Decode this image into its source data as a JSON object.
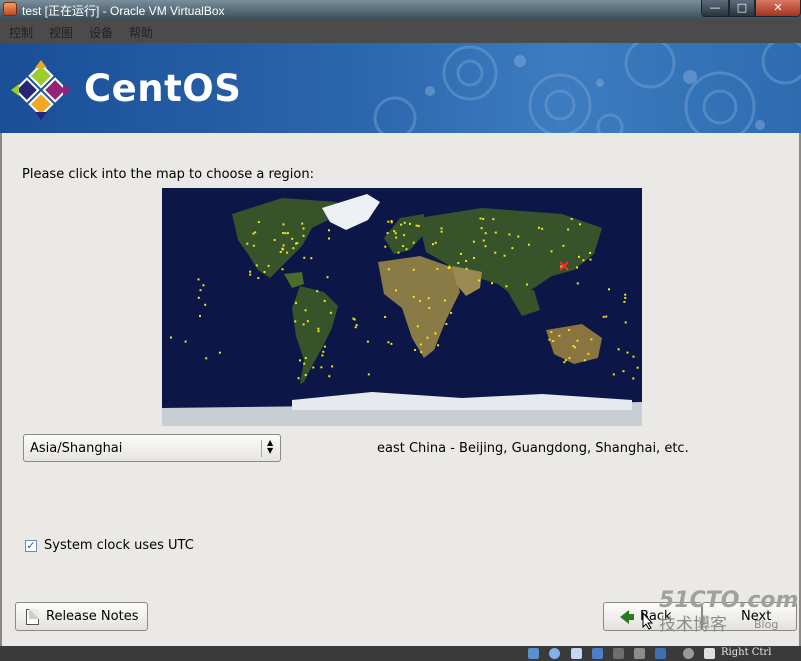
{
  "window": {
    "title": "test [正在运行] - Oracle VM VirtualBox",
    "controls": {
      "minimize": "—",
      "maximize": "□",
      "close": "✕"
    }
  },
  "menubar": {
    "items": [
      "控制",
      "视图",
      "设备",
      "帮助"
    ]
  },
  "banner": {
    "brand": "CentOS"
  },
  "timezone_page": {
    "prompt": "Please click into the map to choose a region:",
    "selected_timezone": "Asia/Shanghai",
    "timezone_description": "east China - Beijing, Guangdong, Shanghai, etc.",
    "utc_checkbox": {
      "label": "System clock uses UTC",
      "checked": true,
      "mark": "✓"
    }
  },
  "buttons": {
    "release_notes": "Release Notes",
    "back": "Back",
    "next": "Next"
  },
  "watermark": {
    "site": "51CTO.com",
    "tagline": "技术博客",
    "blog": "Blog"
  },
  "statusbar": {
    "host_key": "Right Ctrl"
  },
  "colors": {
    "banner": "#2c66ad",
    "guest_bg": "#ebe9e5",
    "map_ocean": "#0d1747",
    "city_dot": "#f2e51e",
    "selected_city": "#ff2a2a"
  }
}
